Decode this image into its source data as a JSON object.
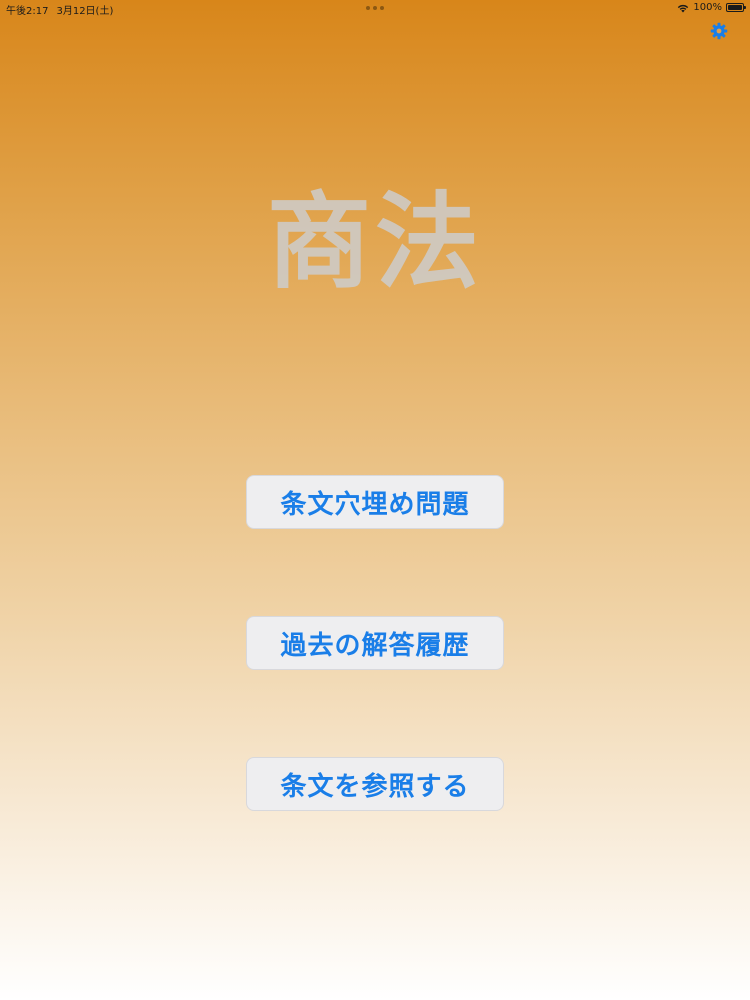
{
  "status_bar": {
    "time": "午後2:17",
    "date": "3月12日(土)",
    "battery_percent": "100%",
    "battery_level": 1.0
  },
  "title": "商法",
  "menu": {
    "blank_fill_label": "条文穴埋め問題",
    "history_label": "過去の解答履歴",
    "reference_label": "条文を参照する"
  },
  "colors": {
    "background_top": "#d8861a",
    "background_bottom": "#ffffff",
    "button_text": "#1a7ee8",
    "button_bg": "#eeeef0",
    "title_text": "#cdcdcd"
  },
  "icons": {
    "settings": "gear-icon",
    "wifi": "wifi-icon",
    "battery": "battery-icon"
  }
}
